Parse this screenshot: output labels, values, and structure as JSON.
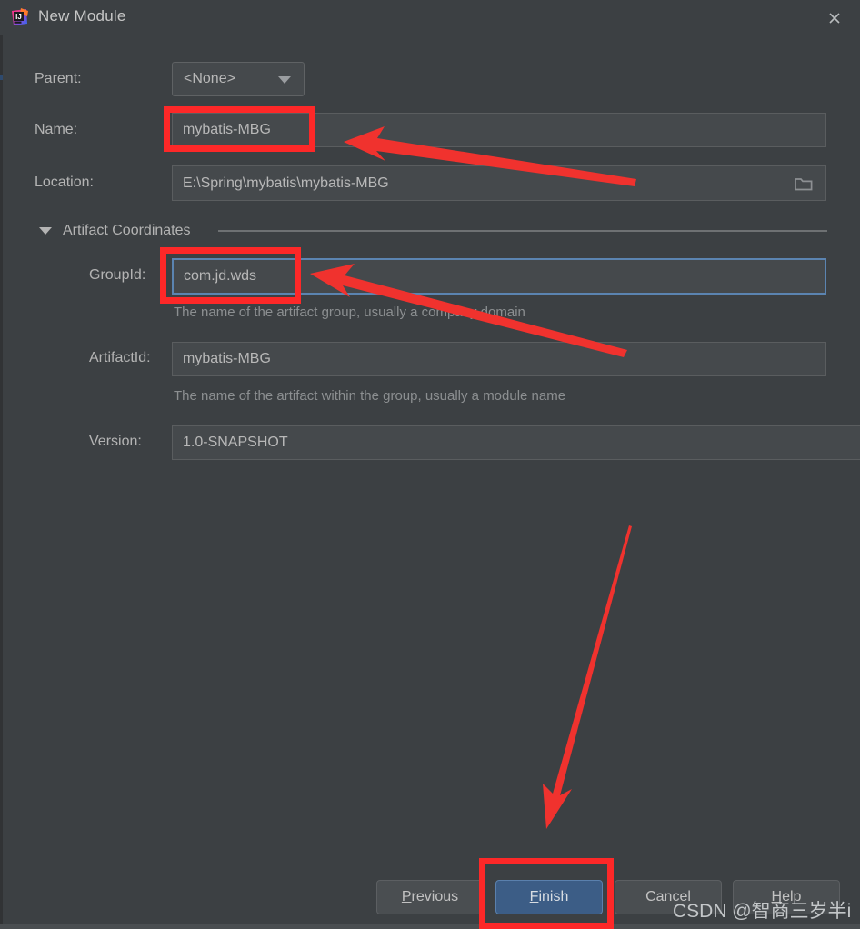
{
  "window": {
    "title": "New Module",
    "app_icon": "intellij-idea-icon",
    "close_icon": "close-icon",
    "background_color": "#3c4043"
  },
  "form": {
    "parent": {
      "label": "Parent:",
      "value": "<None>",
      "dropdown_icon": "chevron-down-icon"
    },
    "name": {
      "label": "Name:",
      "value": "mybatis-MBG"
    },
    "location": {
      "label": "Location:",
      "value": "E:\\Spring\\mybatis\\mybatis-MBG",
      "browse_icon": "folder-icon"
    },
    "artifact_coordinates": {
      "label": "Artifact Coordinates",
      "expanded": true,
      "collapse_icon": "triangle-down-icon",
      "group_id": {
        "label": "GroupId:",
        "value": "com.jd.wds",
        "hint": "The name of the artifact group, usually a company domain",
        "focused": true
      },
      "artifact_id": {
        "label": "ArtifactId:",
        "value": "mybatis-MBG",
        "hint": "The name of the artifact within the group, usually a module name"
      },
      "version": {
        "label": "Version:",
        "value": "1.0-SNAPSHOT"
      }
    }
  },
  "footer": {
    "previous": "Previous",
    "previous_mnemonic": "P",
    "finish": "Finish",
    "finish_mnemonic": "F",
    "cancel": "Cancel",
    "help": "Help",
    "help_mnemonic": "H"
  },
  "annotations": {
    "accent_color": "#fd2828",
    "highlight_boxes": [
      {
        "name": "name-field-highlight"
      },
      {
        "name": "groupid-field-highlight"
      },
      {
        "name": "finish-button-highlight"
      }
    ],
    "arrows": [
      {
        "name": "arrow-to-name-field"
      },
      {
        "name": "arrow-to-groupid-field"
      },
      {
        "name": "arrow-to-finish-button"
      }
    ]
  },
  "watermark": {
    "text": "CSDN @智商三岁半i"
  }
}
